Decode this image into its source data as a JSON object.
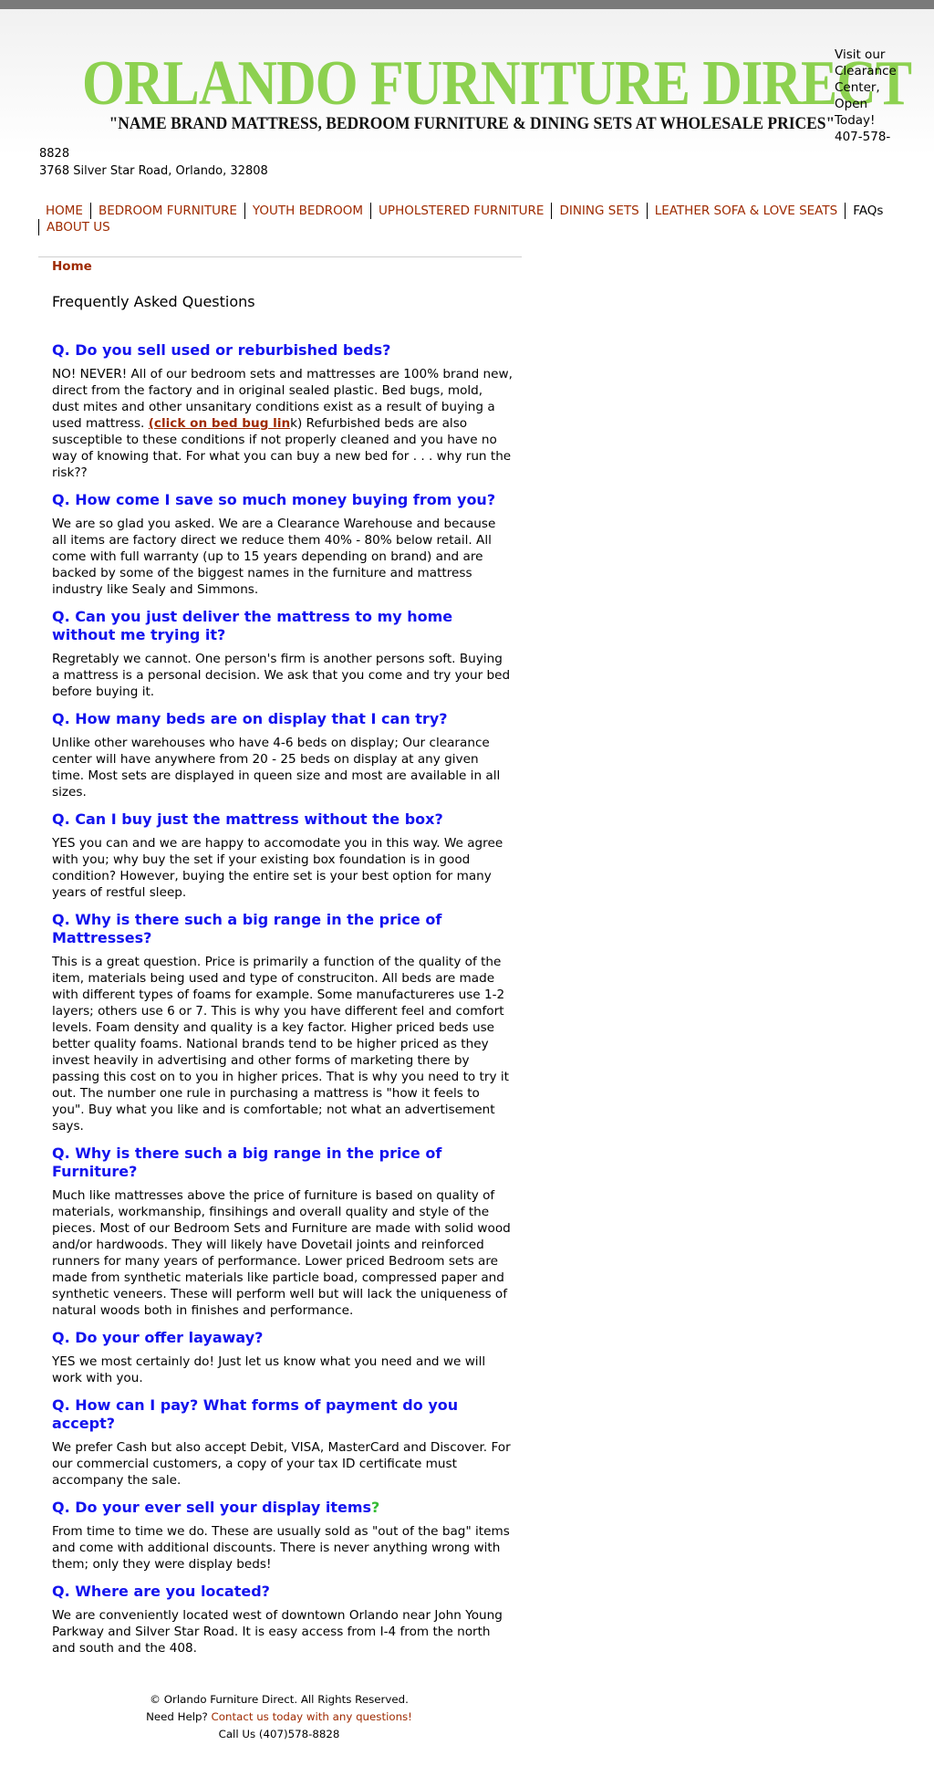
{
  "header": {
    "title": "ORLANDO FURNITURE DIRECT",
    "tagline": "\"NAME BRAND MATTRESS, BEDROOM FURNITURE & DINING SETS AT WHOLESALE PRICES\"",
    "promo_line1": "Visit our",
    "promo_line2": "Clearance",
    "promo_line3": "Center,",
    "promo_line4": "Open",
    "promo_line5": "Today!",
    "promo_line6": "407-578-",
    "phone_end": "8828",
    "address": "3768 Silver Star Road, Orlando, 32808",
    "title_color": "#8dd150"
  },
  "nav": {
    "items": [
      {
        "label": "HOME"
      },
      {
        "label": "BEDROOM FURNITURE"
      },
      {
        "label": "YOUTH BEDROOM"
      },
      {
        "label": "UPHOLSTERED FURNITURE"
      },
      {
        "label": "DINING SETS"
      },
      {
        "label": "LEATHER SOFA & LOVE SEATS"
      },
      {
        "label": "FAQs"
      },
      {
        "label": "ABOUT US"
      }
    ],
    "link_color": "#9e2a00"
  },
  "breadcrumb": "Home",
  "page_title": "Frequently Asked Questions",
  "faq": [
    {
      "q": "Q. Do you sell used or reburbished beds?",
      "a_before": "NO! NEVER! All of our bedroom sets and mattresses are 100% brand new, direct from the factory and in original sealed plastic. Bed bugs, mold, dust mites and other unsanitary conditions exist as a result of buying a used mattress. ",
      "a_link": "(click on bed bug lin",
      "a_link_tail": "k",
      "a_after": ") Refurbished beds are also susceptible to these conditions if not properly cleaned and you have no way of knowing that. For what you can buy a new bed for . . . why run the risk??"
    },
    {
      "q": "Q. How come I save so much money buying from you?",
      "a": "We are so glad you asked. We are a Clearance Warehouse and because all items are factory direct we reduce them 40% - 80% below retail. All come with full warranty (up to 15 years depending on brand) and are backed by some of the biggest names in the furniture and mattress industry like Sealy and Simmons."
    },
    {
      "q": "Q. Can you just deliver the mattress to my home without me trying it?",
      "a": "Regretably we cannot. One person's firm is another persons soft. Buying a mattress is a personal decision. We ask that you come and try your bed before buying it."
    },
    {
      "q": "Q. How many beds are on display that I can try?",
      "a": "Unlike other warehouses who have 4-6 beds on display; Our clearance center will have anywhere from 20 - 25 beds on display at any given time. Most sets are displayed in queen size and most are available in all sizes."
    },
    {
      "q": "Q. Can I buy just the mattress without the box?",
      "a": "YES you can and we are happy to accomodate you in this way. We agree with you; why buy the set if your existing box foundation is in good condition? However, buying the entire set is your best option for many years of restful sleep."
    },
    {
      "q": "Q. Why is there such a big range in the price of Mattresses?",
      "a": "This is a great question. Price is primarily a function of the quality of the item, materials being used and type of construciton. All beds are made with different types of foams for example. Some manufactureres use 1-2 layers; others use 6 or 7. This is why you have different feel and comfort levels. Foam density and quality is a key factor. Higher priced beds use better quality foams. National brands tend to be higher priced as they invest heavily in advertising and other forms of marketing there by passing this cost on to you in higher prices. That is why you need to try it out. The number one rule in purchasing a mattress is \"how it feels to you\". Buy what you like and is comfortable; not what an advertisement says."
    },
    {
      "q": "Q. Why is there such a big range in the price of Furniture?",
      "a": "Much like mattresses above the price of furniture is based on quality of materials, workmanship, finsihings and overall quality and style of the pieces. Most of our Bedroom Sets and Furniture are made with solid wood and/or hardwoods. They will likely have Dovetail joints and reinforced runners for many years of performance. Lower priced Bedroom sets are made from synthetic materials like particle boad, compressed paper and synthetic veneers. These will perform well but will lack the uniqueness of natural woods both in finishes and performance."
    },
    {
      "q": "Q. Do your offer layaway?",
      "a": "YES we most certainly do! Just let us know what you need and we will work with you."
    },
    {
      "q": "Q. How can I pay? What forms of payment do you accept?",
      "a": "We prefer Cash but also accept Debit, VISA, MasterCard and Discover. For our commercial customers, a copy of your tax ID certificate must accompany the sale."
    },
    {
      "q": "Q. Do your ever sell your display items",
      "q_mark": "?",
      "a": "From time to time we do. These are usually sold as \"out of the bag\" items and come with additional discounts. There is never anything wrong with them; only they were display beds!"
    },
    {
      "q": "Q. Where are you located?",
      "a": "We are conveniently located west of downtown Orlando near John Young Parkway and Silver Star Road. It is easy access from I-4 from the north and south and the 408."
    }
  ],
  "footer": {
    "copyright": "© Orlando Furniture Direct. All Rights Reserved.",
    "help_prefix": "Need Help?",
    "help_link": "Contact us today with any questions!",
    "call": "Call Us (407)578-8828"
  }
}
